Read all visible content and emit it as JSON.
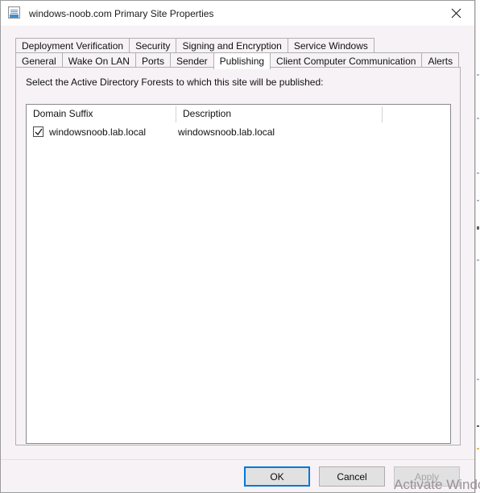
{
  "window": {
    "title": "windows-noob.com Primary Site Properties",
    "icon": "properties-sheet-icon",
    "close_label": "✕"
  },
  "tabs": {
    "row1": [
      {
        "label": "Deployment Verification",
        "selected": false
      },
      {
        "label": "Security",
        "selected": false
      },
      {
        "label": "Signing and Encryption",
        "selected": false
      },
      {
        "label": "Service Windows",
        "selected": false
      }
    ],
    "row2": [
      {
        "label": "General",
        "selected": false
      },
      {
        "label": "Wake On LAN",
        "selected": false
      },
      {
        "label": "Ports",
        "selected": false
      },
      {
        "label": "Sender",
        "selected": false
      },
      {
        "label": "Publishing",
        "selected": true
      },
      {
        "label": "Client Computer Communication",
        "selected": false
      },
      {
        "label": "Alerts",
        "selected": false
      }
    ]
  },
  "panel": {
    "instruction": "Select the Active Directory Forests to which this site will be published:"
  },
  "list": {
    "columns": [
      {
        "label": "Domain Suffix"
      },
      {
        "label": "Description"
      },
      {
        "label": ""
      }
    ],
    "rows": [
      {
        "checked": true,
        "domain_suffix": "windowsnoob.lab.local",
        "description": "windowsnoob.lab.local"
      }
    ]
  },
  "footer": {
    "ok_label": "OK",
    "cancel_label": "Cancel",
    "apply_label": "Apply"
  },
  "overlay": {
    "activation_watermark": "Activate Windows"
  },
  "colors": {
    "dialog_background": "#f7f2f5",
    "titlebar_background": "#ffffff",
    "focus_accent": "#0078d7",
    "listview_background": "#ffffff",
    "border": "#b0b0b0",
    "disabled_text": "#a6a6a6"
  }
}
